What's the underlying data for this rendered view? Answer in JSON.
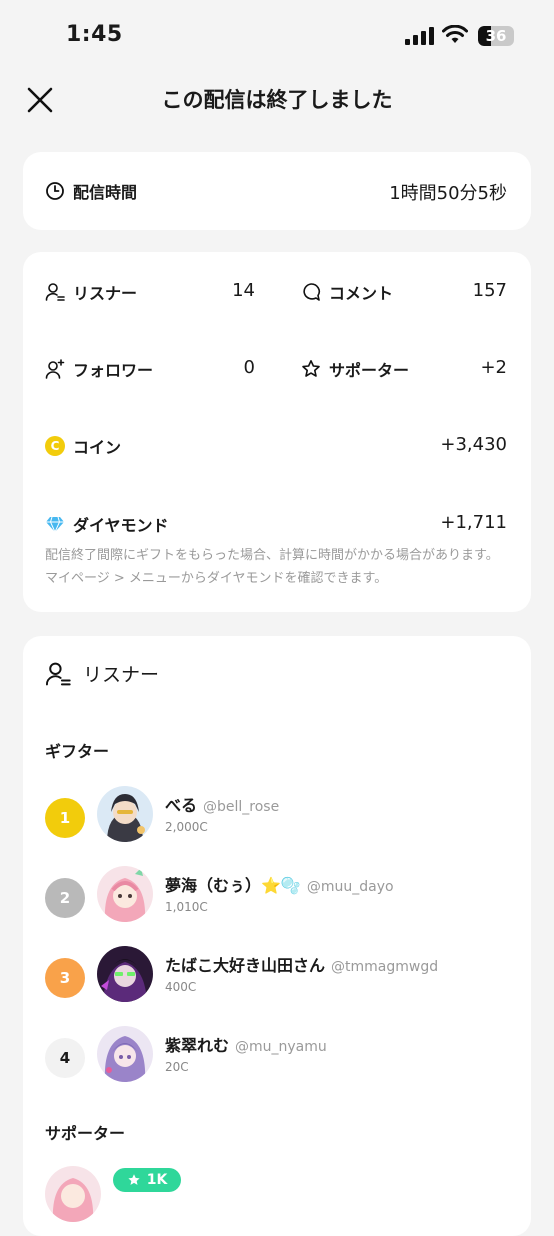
{
  "status": {
    "time": "1:45",
    "battery": "36",
    "battery_level": 0.36
  },
  "header": {
    "title": "この配信は終了しました"
  },
  "duration": {
    "label": "配信時間",
    "value": "1時間50分5秒"
  },
  "stats": {
    "listeners": {
      "label": "リスナー",
      "value": "14"
    },
    "comments": {
      "label": "コメント",
      "value": "157"
    },
    "followers": {
      "label": "フォロワー",
      "value": "0"
    },
    "supporters": {
      "label": "サポーター",
      "value": "+2"
    },
    "coins": {
      "label": "コイン",
      "value": "+3,430",
      "icon_letter": "C"
    },
    "diamonds": {
      "label": "ダイヤモンド",
      "value": "+1,711"
    },
    "note": "配信終了間際にギフトをもらった場合、計算に時間がかかる場合があります。マイページ > メニューからダイヤモンドを確認できます。"
  },
  "listeners_section": {
    "title": "リスナー",
    "gifters_title": "ギフター",
    "gifters": [
      {
        "rank": "1",
        "name": "べる",
        "handle": "@bell_rose",
        "coins": "2,000C",
        "rank_color": "#f2cc0c"
      },
      {
        "rank": "2",
        "name": "夢海（むぅ）⭐🫧",
        "handle": "@muu_dayo",
        "coins": "1,010C",
        "rank_color": "#b9b9b9"
      },
      {
        "rank": "3",
        "name": "たばこ大好き山田さん",
        "handle": "@tmmagmwgd",
        "coins": "400C",
        "rank_color": "#f9a24a"
      },
      {
        "rank": "4",
        "name": "紫翠れむ",
        "handle": "@mu_nyamu",
        "coins": "20C",
        "rank_color": "#f2f2f2"
      }
    ],
    "supporters_title": "サポーター",
    "supporter_badge": "1K"
  },
  "colors": {
    "accent_green": "#2fd79a",
    "coin_yellow": "#f2cc0c",
    "gray_text": "#9a9a9a"
  }
}
